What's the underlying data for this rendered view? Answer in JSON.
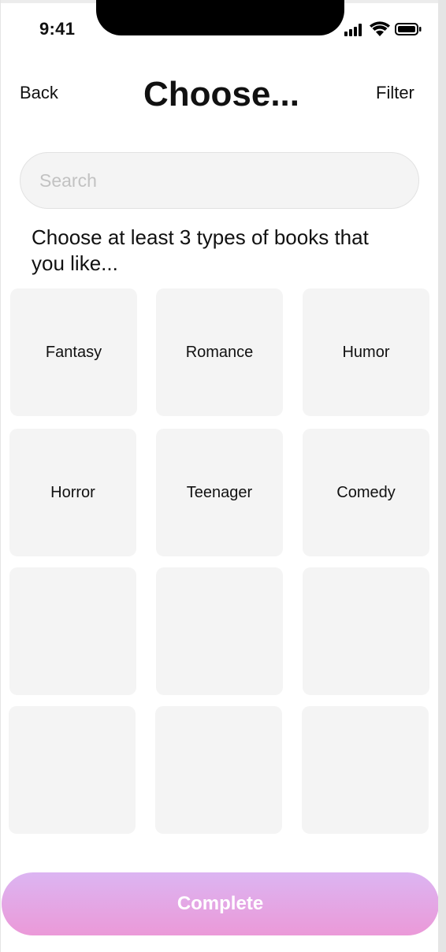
{
  "status_bar": {
    "time": "9:41",
    "icons": [
      "cellular-signal-icon",
      "wifi-icon",
      "battery-icon"
    ]
  },
  "nav": {
    "back_label": "Back",
    "title": "Choose...",
    "filter_label": "Filter"
  },
  "search": {
    "placeholder": "Search",
    "value": ""
  },
  "instruction": "Choose at least 3 types of books that you like...",
  "genres": [
    "Fantasy",
    "Romance",
    "Humor",
    "Horror",
    "Teenager",
    "Comedy",
    "",
    "",
    "",
    "",
    "",
    ""
  ],
  "complete_label": "Complete",
  "colors": {
    "background": "#ffffff",
    "tile": "#f4f4f4",
    "button_gradient_top": "#dcb5f2",
    "button_gradient_bottom": "#eb99d8",
    "placeholder": "#c2c2c2"
  }
}
